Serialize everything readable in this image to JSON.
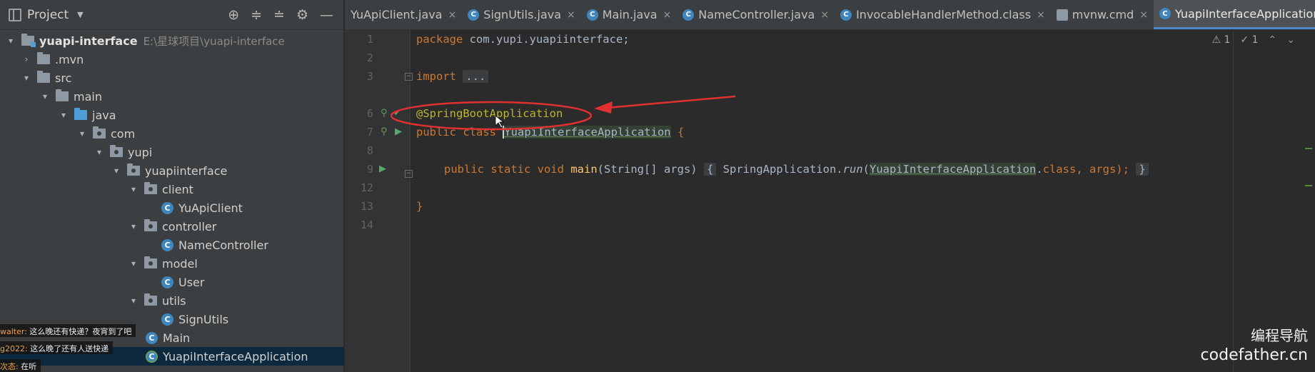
{
  "project_panel": {
    "title": "Project",
    "tools": [
      "target-icon",
      "expand-all-icon",
      "collapse-all-icon",
      "gear-icon",
      "hide-icon"
    ],
    "tree": [
      {
        "label": "yuapi-interface",
        "path": "E:\\星球项目\\yuapi-interface",
        "type": "module",
        "chevron": "v"
      },
      {
        "label": ".mvn",
        "type": "folder",
        "chevron": ">"
      },
      {
        "label": "src",
        "type": "folder",
        "chevron": "v"
      },
      {
        "label": "main",
        "type": "folder",
        "chevron": "v"
      },
      {
        "label": "java",
        "type": "folder-blue",
        "chevron": "v"
      },
      {
        "label": "com",
        "type": "package",
        "chevron": "v"
      },
      {
        "label": "yupi",
        "type": "package",
        "chevron": "v"
      },
      {
        "label": "yuapiinterface",
        "type": "package",
        "chevron": "v"
      },
      {
        "label": "client",
        "type": "package",
        "chevron": "v"
      },
      {
        "label": "YuApiClient",
        "type": "class",
        "chevron": ""
      },
      {
        "label": "controller",
        "type": "package",
        "chevron": "v"
      },
      {
        "label": "NameController",
        "type": "class",
        "chevron": ""
      },
      {
        "label": "model",
        "type": "package",
        "chevron": "v"
      },
      {
        "label": "User",
        "type": "class",
        "chevron": ""
      },
      {
        "label": "utils",
        "type": "package",
        "chevron": "v"
      },
      {
        "label": "SignUtils",
        "type": "class",
        "chevron": ""
      },
      {
        "label": "Main",
        "type": "class",
        "chevron": ""
      },
      {
        "label": "YuapiInterfaceApplication",
        "type": "class-spring",
        "chevron": "",
        "selected": true
      }
    ]
  },
  "chat_overlay": [
    {
      "nick": "walter:",
      "message": "这么晚还有快递？夜宵到了吧"
    },
    {
      "nick": "g2022:",
      "message": "这么晚了还有人送快递"
    },
    {
      "nick": "次态:",
      "message": "在听"
    }
  ],
  "tabs": [
    {
      "label": "YuApiClient.java",
      "icon": "none",
      "active": false
    },
    {
      "label": "SignUtils.java",
      "icon": "class",
      "active": false
    },
    {
      "label": "Main.java",
      "icon": "class",
      "active": false
    },
    {
      "label": "NameController.java",
      "icon": "class",
      "active": false
    },
    {
      "label": "InvocableHandlerMethod.class",
      "icon": "class",
      "active": false
    },
    {
      "label": "mvnw.cmd",
      "icon": "file",
      "active": false
    },
    {
      "label": "YuapiInterfaceApplication.java",
      "icon": "class",
      "active": true
    }
  ],
  "editor": {
    "line_numbers": [
      "1",
      "2",
      "3",
      "6",
      "7",
      "8",
      "9",
      "12",
      "13",
      "14"
    ],
    "code": {
      "l1_kw": "package",
      "l1_rest": " com.yupi.yuapiinterface;",
      "l3_kw": "import",
      "l3_fold": "...",
      "l6_ann": "@SpringBootApplication",
      "l7_kw": "public class",
      "l7_name": "YuapiInterfaceApplication",
      "l7_brace": " {",
      "l9_kw": "public static void",
      "l9_fn": "main",
      "l9_params": "(String[] args)",
      "l9_open": "{",
      "l9_call_obj": "SpringApplication.",
      "l9_call_fn": "run",
      "l9_paren_open": "(",
      "l9_arg_cls": "YuapiInterfaceApplication",
      "l9_dot": ".",
      "l9_kw_class": "class",
      "l9_args_rest": ", args);",
      "l9_close": "}",
      "l13_close": "}"
    },
    "inspection": {
      "warnings": "1",
      "weak_warnings": "1"
    }
  },
  "watermark": {
    "cn": "编程导航",
    "en": "codefather.cn"
  },
  "colors": {
    "annotation_red": "#e03030",
    "selection": "#0d293e",
    "active_tab_underline": "#4a88c7"
  }
}
